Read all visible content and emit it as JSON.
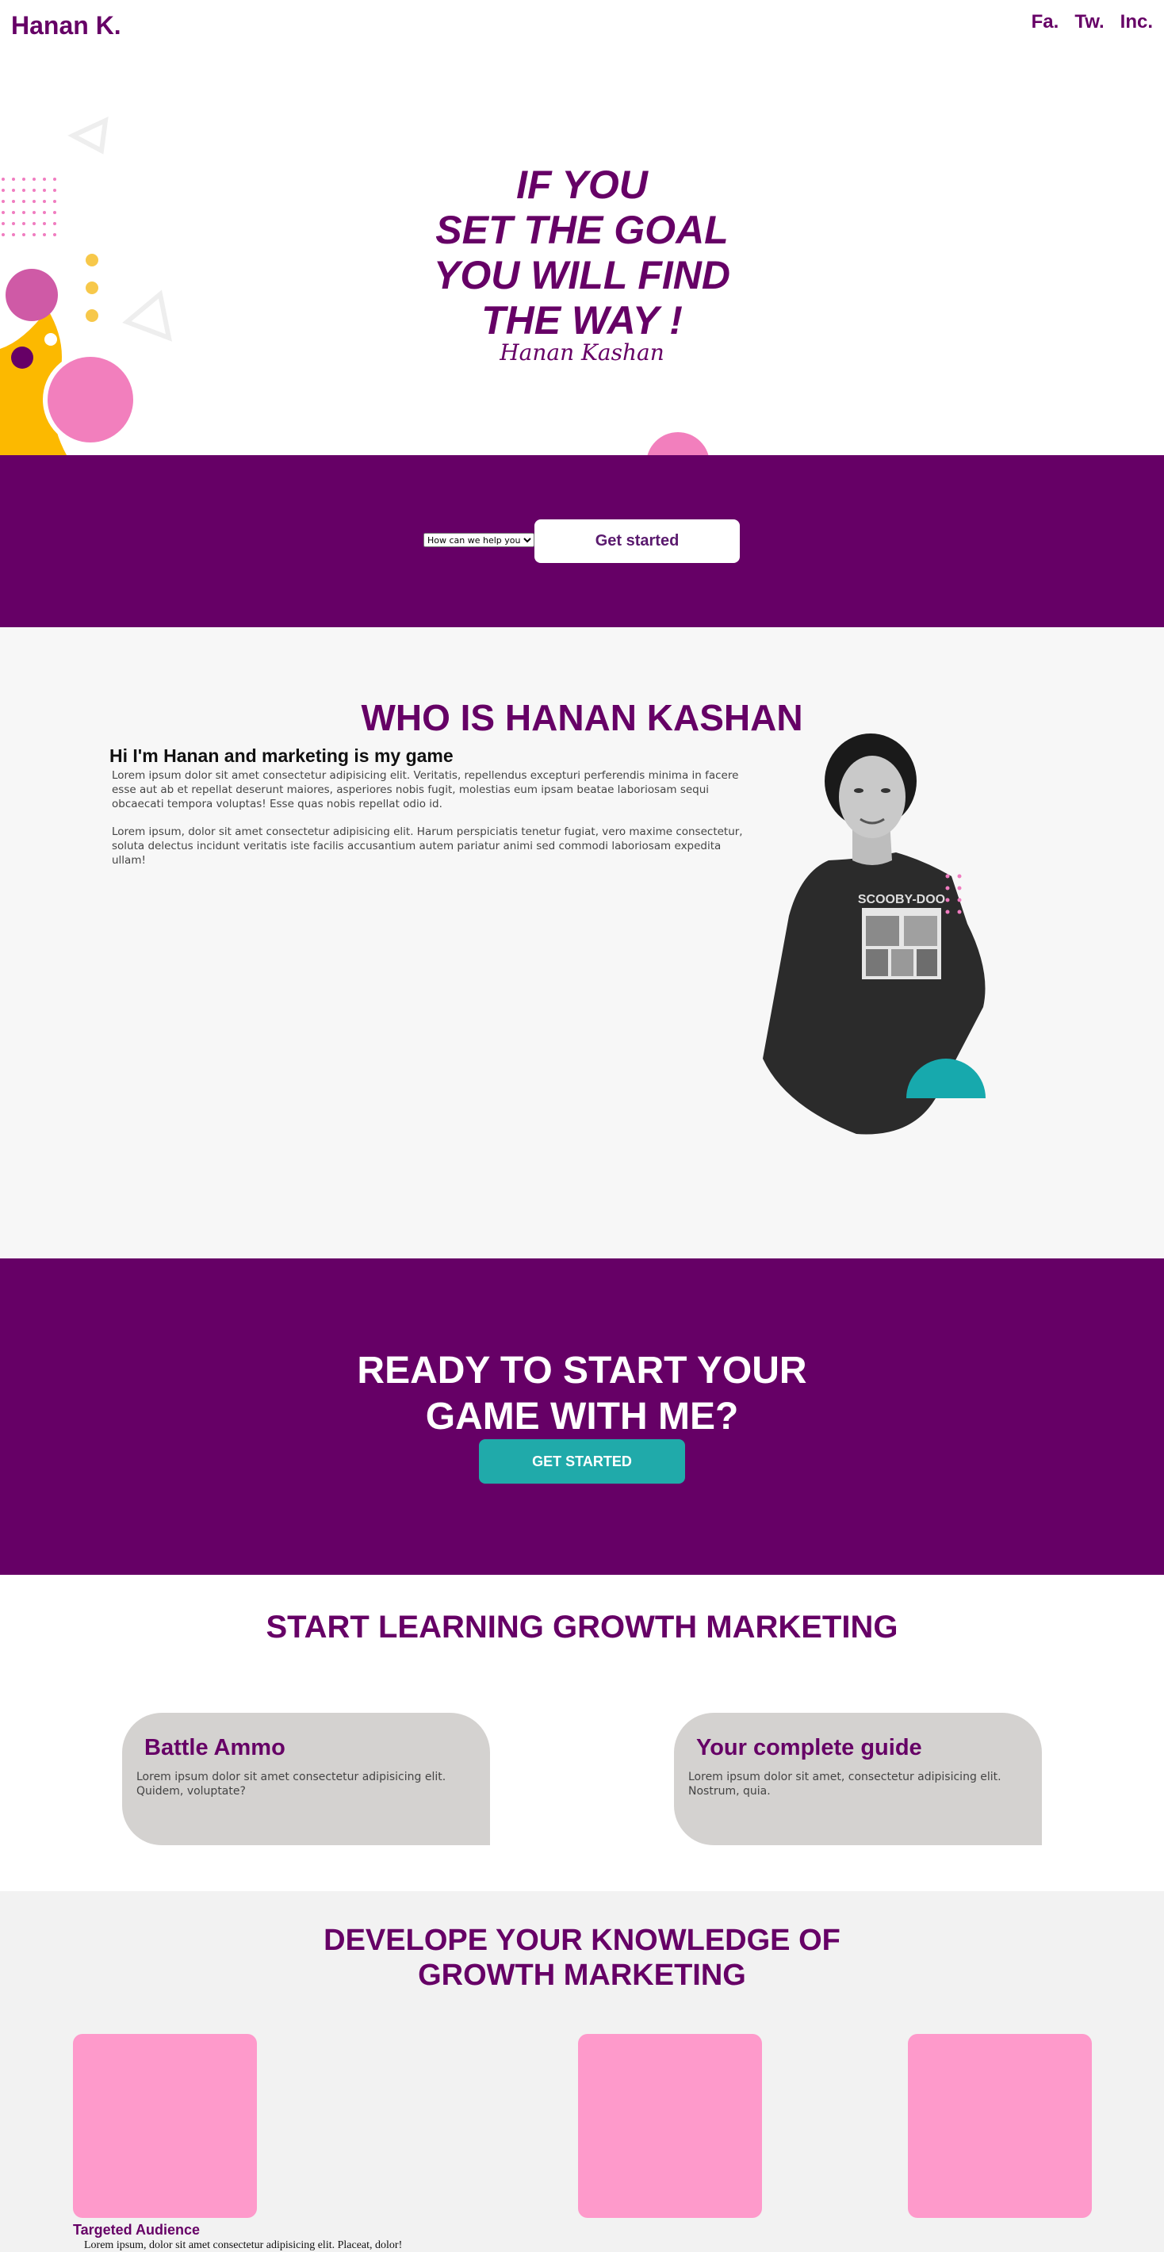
{
  "header": {
    "logo": "Hanan K.",
    "nav": [
      "Fa.",
      "Tw.",
      "Inc."
    ]
  },
  "hero": {
    "lines": [
      "IF YOU",
      "SET THE GOAL",
      "YOU WILL FIND",
      "THE WAY !"
    ],
    "signature": "Hanan Kashan"
  },
  "cta": {
    "select_value": "How can we help you",
    "button": "Get started"
  },
  "about": {
    "title": "WHO IS HANAN KASHAN",
    "subtitle": "Hi I'm Hanan and marketing is my game",
    "paragraph1": "Lorem ipsum dolor sit amet consectetur adipisicing elit. Veritatis, repellendus excepturi perferendis minima in facere esse aut ab et repellat deserunt maiores, asperiores nobis fugit, molestias eum ipsam beatae laboriosam sequi obcaecati tempora voluptas! Esse quas nobis repellat odio id.",
    "paragraph2": "Lorem ipsum, dolor sit amet consectetur adipisicing elit. Harum perspiciatis tenetur fugiat, vero maxime consectetur, soluta delectus incidunt veritatis iste facilis accusantium autem pariatur animi sed commodi laboriosam expedita ullam!",
    "photo_shirt_text": "SCOOBY-DOO"
  },
  "ready": {
    "title_line1": "READY TO START YOUR",
    "title_line2": "GAME WITH ME?",
    "button": "GET STARTED"
  },
  "learning": {
    "title": "START LEARNING GROWTH MARKETING",
    "cards": [
      {
        "title": "Battle Ammo",
        "text": "Lorem ipsum dolor sit amet consectetur adipisicing elit. Quidem, voluptate?"
      },
      {
        "title": "Your complete guide",
        "text": "Lorem ipsum dolor sit amet, consectetur adipisicing elit. Nostrum, quia."
      }
    ]
  },
  "knowledge": {
    "title_line1": "DEVELOPE YOUR KNOWLEDGE OF",
    "title_line2": "GROWTH MARKETING",
    "item_title": "Targeted Audience",
    "item_text": "Lorem ipsum, dolor sit amet consectetur adipisicing elit. Placeat, dolor!"
  },
  "colors": {
    "brand_purple": "#660066",
    "teal": "#20aaaa",
    "pink": "#fe9acb",
    "yellow": "#fcb900"
  }
}
